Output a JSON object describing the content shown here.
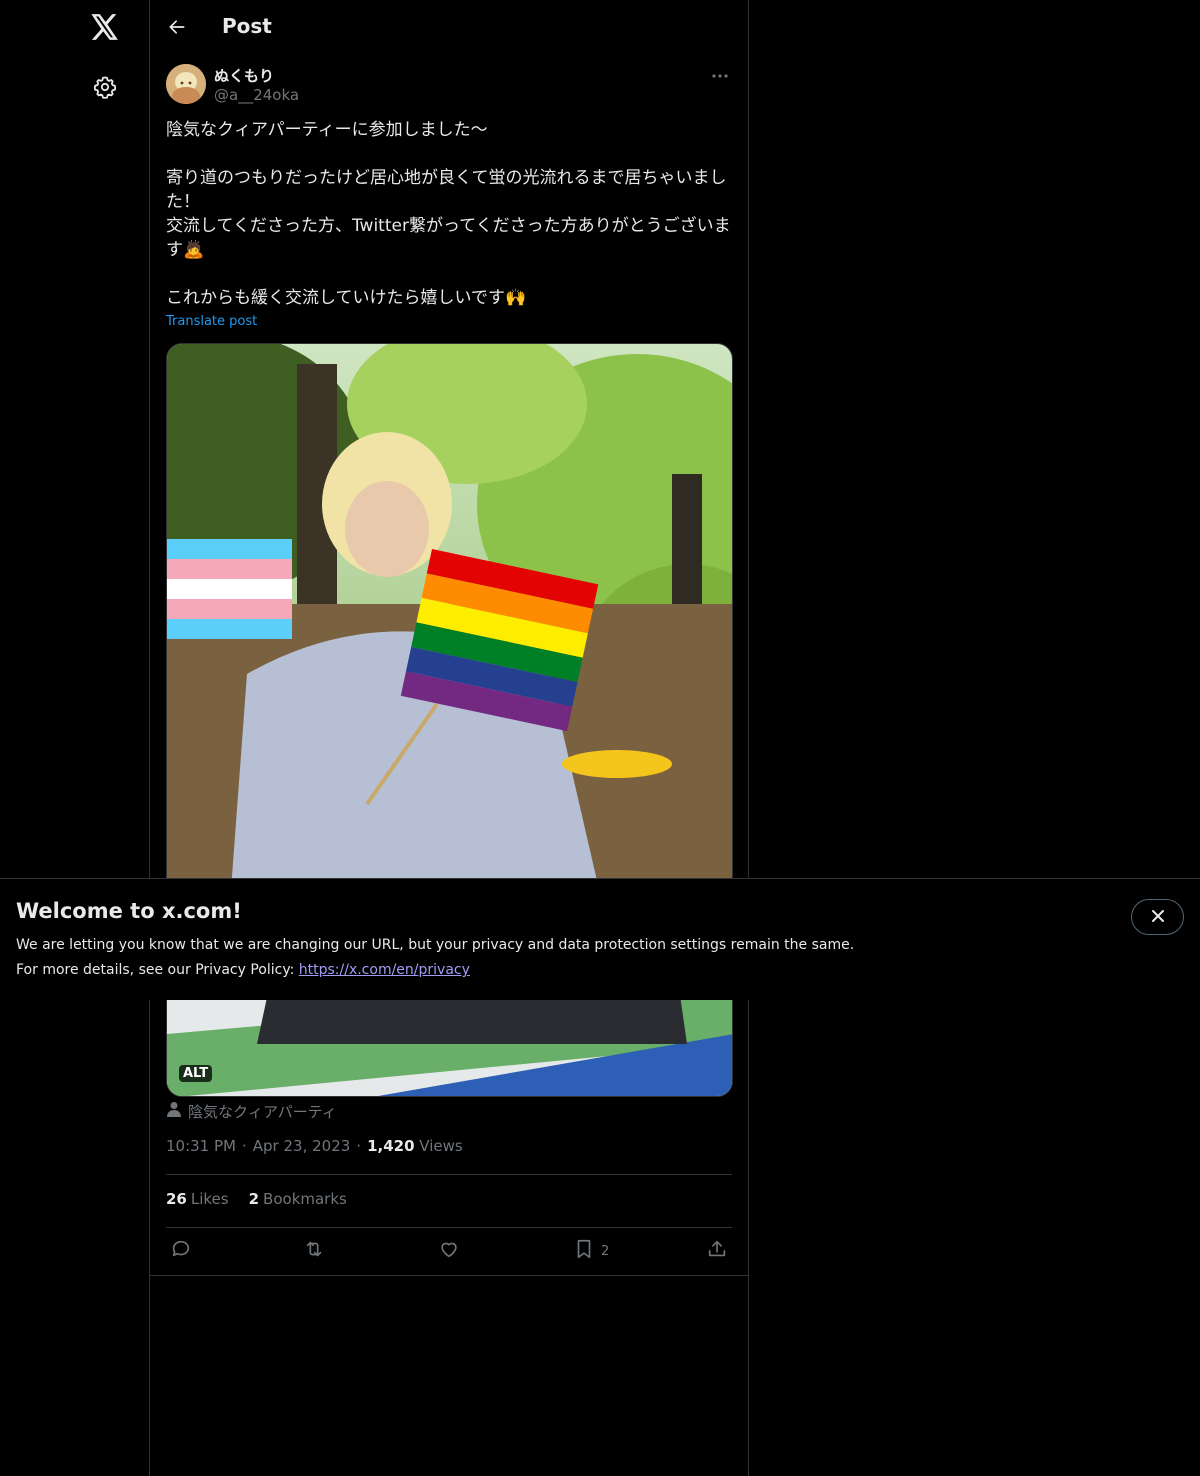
{
  "header": {
    "title": "Post"
  },
  "author": {
    "name": "ぬくもり",
    "handle": "@a__24oka"
  },
  "post": {
    "line1": "陰気なクィアパーティーに参加しました〜",
    "line2": "寄り道のつもりだったけど居心地が良くて蛍の光流れるまで居ちゃいまし",
    "line3": "た！",
    "line4": "交流してくださった方、Twitter繋がってくださった方ありがとうございま",
    "line5": "す🙇",
    "line6": "これからも緩く交流していけたら嬉しいです🙌",
    "translate_label": "Translate post"
  },
  "media": {
    "alt_label": "ALT"
  },
  "tagged": {
    "text": "陰気なクィアパーティ"
  },
  "meta": {
    "time": "10:31 PM",
    "dot1": "·",
    "date": "Apr 23, 2023",
    "dot2": "·",
    "views_count": "1,420",
    "views_label": "Views"
  },
  "stats": {
    "likes_count": "26",
    "likes_label": "Likes",
    "bookmarks_count": "2",
    "bookmarks_label": "Bookmarks"
  },
  "actions": {
    "bookmark_count": "2"
  },
  "banner": {
    "title": "Welcome to x.com!",
    "line1": "We are letting you know that we are changing our URL, but your privacy and data protection settings remain the same.",
    "line2_prefix": "For more details, see our Privacy Policy: ",
    "link": "https://x.com/en/privacy"
  },
  "colors": {
    "background": "#000000",
    "text": "#e7e9ea",
    "muted": "#71767b",
    "accent": "#1d9bf0",
    "link": "#a29cf4",
    "border": "#2f3336"
  },
  "icons": [
    "x-logo-icon",
    "settings-icon",
    "back-arrow-icon",
    "more-icon",
    "person-icon",
    "reply-icon",
    "repost-icon",
    "like-icon",
    "bookmark-icon",
    "share-icon",
    "close-icon"
  ]
}
